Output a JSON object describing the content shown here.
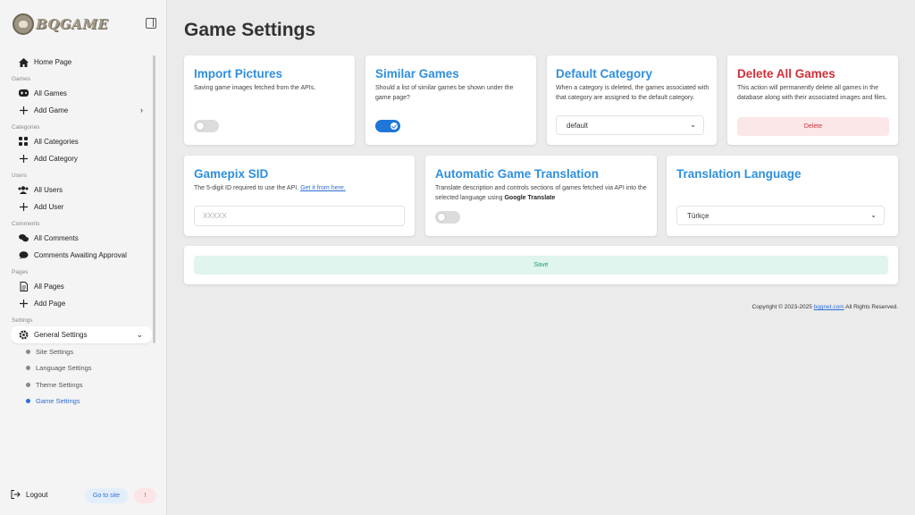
{
  "brand": {
    "name": "BQGAME"
  },
  "sidebar": {
    "home": "Home Page",
    "sections": {
      "games": "Games",
      "categories": "Categories",
      "users": "Users",
      "comments": "Comments",
      "pages": "Pages",
      "settings": "Settings"
    },
    "items": {
      "all_games": "All Games",
      "add_game": "Add Game",
      "all_categories": "All Categories",
      "add_category": "Add Category",
      "all_users": "All Users",
      "add_user": "Add User",
      "all_comments": "All Comments",
      "comments_awaiting": "Comments Awaiting Approval",
      "all_pages": "All Pages",
      "add_page": "Add Page",
      "general_settings": "General Settings"
    },
    "sub_items": {
      "site": "Site Settings",
      "language": "Language Settings",
      "theme": "Theme Settings",
      "game": "Game Settings"
    },
    "logout": "Logout",
    "goto_site": "Go to site",
    "alert": "!"
  },
  "main": {
    "title": "Game Settings",
    "cards": {
      "import_pictures": {
        "title": "Import Pictures",
        "desc": "Saving game images fetched from the APIs.",
        "enabled": false
      },
      "similar_games": {
        "title": "Similar Games",
        "desc": "Should a list of similar games be shown under the game page?",
        "enabled": true
      },
      "default_category": {
        "title": "Default Category",
        "desc": "When a category is deleted, the games associated with that category are assigned to the default category.",
        "value": "default"
      },
      "delete_all": {
        "title": "Delete All Games",
        "desc": "This action will permanently delete all games in the database along with their associated images and files.",
        "button": "Delete"
      },
      "gamepix": {
        "title": "Gamepix SID",
        "desc": "The 5-digit ID required to use the API.",
        "link": "Get it from here.",
        "placeholder": "XXXXX"
      },
      "auto_translate": {
        "title": "Automatic Game Translation",
        "desc_1": "Translate description and controls sections of games fetched via API into the selected language using",
        "desc_bold": "Google Translate",
        "enabled": false
      },
      "translation_lang": {
        "title": "Translation Language",
        "value": "Türkçe"
      }
    },
    "save": "Save",
    "footer": {
      "prefix": "Copyright © 2023-2025",
      "link": "bqgnet.com",
      "suffix": "All Rights Reserved."
    }
  },
  "colors": {
    "accent": "#2f8fde",
    "danger": "#d32f3a",
    "success": "#16a06a"
  }
}
